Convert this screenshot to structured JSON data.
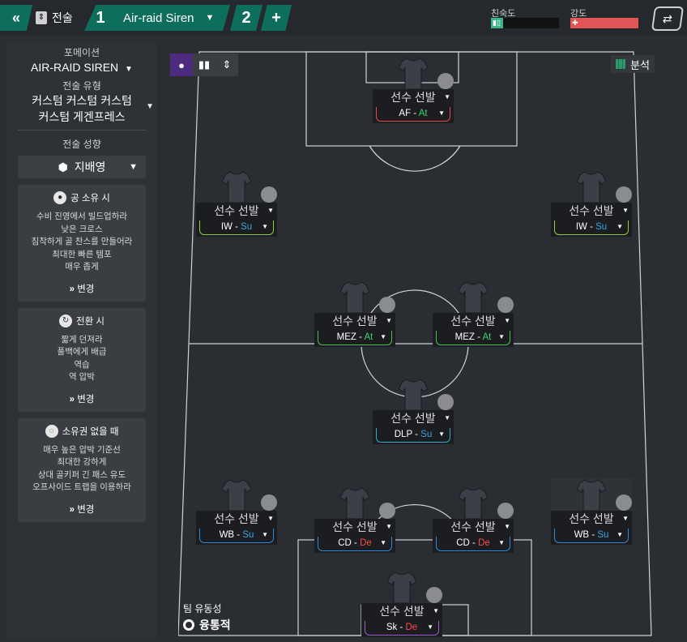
{
  "topbar": {
    "back_icon": "double-chevron-left",
    "tactics_label": "전술",
    "slot1_number": "1",
    "slot1_name": "Air-raid Siren",
    "slot2_number": "2",
    "add_label": "+",
    "familiarity": {
      "label": "친숙도",
      "value": 0.18,
      "color": "#3bb38a"
    },
    "intensity": {
      "label": "강도",
      "value": 1.0,
      "color": "#e05555"
    }
  },
  "sidebar": {
    "formation_label": "포메이션",
    "formation_value": "AIR-RAID SIREN",
    "style_label": "전술 유형",
    "style_value_line1": "커스텀 커스텀 커스텀",
    "style_value_line2": "커스텀 게겐프레스",
    "mentality_label": "전술 성향",
    "mentality_value": "지배영",
    "in_possession": {
      "title": "공 소유 시",
      "lines": [
        "수비 진영에서 빌드업하라",
        "낮은 크로스",
        "침착하게 골 찬스를 만들어라",
        "최대한 빠른 템포",
        "매우 좁게"
      ],
      "change": "변경"
    },
    "in_transition": {
      "title": "전환 시",
      "lines": [
        "짧게 던져라",
        "풀백에게 배급",
        "역습",
        "역 압박"
      ],
      "change": "변경"
    },
    "out_of_possession": {
      "title": "소유권 없을 때",
      "lines": [
        "매우 높은 압박 기준선",
        "최대한 강하게",
        "상대 골키퍼 긴 패스 유도",
        "오프사이드 트랩을 이용하라"
      ],
      "change": "변경"
    }
  },
  "pitch": {
    "analysis_label": "분석",
    "fluidity_label": "팀 유동성",
    "fluidity_value": "융통적",
    "players": [
      {
        "id": "af",
        "name": "선수 선발",
        "role": "AF",
        "duty": "At",
        "color": "#e04a4a",
        "highlight": false
      },
      {
        "id": "iw-l",
        "name": "선수 선발",
        "role": "IW",
        "duty": "Su",
        "color": "#8ccf3e",
        "highlight": false
      },
      {
        "id": "iw-r",
        "name": "선수 선발",
        "role": "IW",
        "duty": "Su",
        "color": "#8ccf3e",
        "highlight": false
      },
      {
        "id": "mez-l",
        "name": "선수 선발",
        "role": "MEZ",
        "duty": "At",
        "color": "#46c24a",
        "highlight": false
      },
      {
        "id": "mez-r",
        "name": "선수 선발",
        "role": "MEZ",
        "duty": "At",
        "color": "#46c24a",
        "highlight": false
      },
      {
        "id": "dlp",
        "name": "선수 선발",
        "role": "DLP",
        "duty": "Su",
        "color": "#2ab0c8",
        "highlight": false
      },
      {
        "id": "wb-l",
        "name": "선수 선발",
        "role": "WB",
        "duty": "Su",
        "color": "#2f86d8",
        "highlight": false
      },
      {
        "id": "cd-l",
        "name": "선수 선발",
        "role": "CD",
        "duty": "De",
        "color": "#2f86d8",
        "highlight": false
      },
      {
        "id": "cd-r",
        "name": "선수 선발",
        "role": "CD",
        "duty": "De",
        "color": "#2f86d8",
        "highlight": false
      },
      {
        "id": "wb-r",
        "name": "선수 선발",
        "role": "WB",
        "duty": "Su",
        "color": "#2f86d8",
        "highlight": true
      },
      {
        "id": "gk",
        "name": "선수 선발",
        "role": "Sk",
        "duty": "De",
        "color": "#9a5ad0",
        "highlight": false
      }
    ],
    "duty_colors": {
      "At": "#3ed16a",
      "Su": "#3aa6e8",
      "De": "#ff4a4a"
    }
  }
}
